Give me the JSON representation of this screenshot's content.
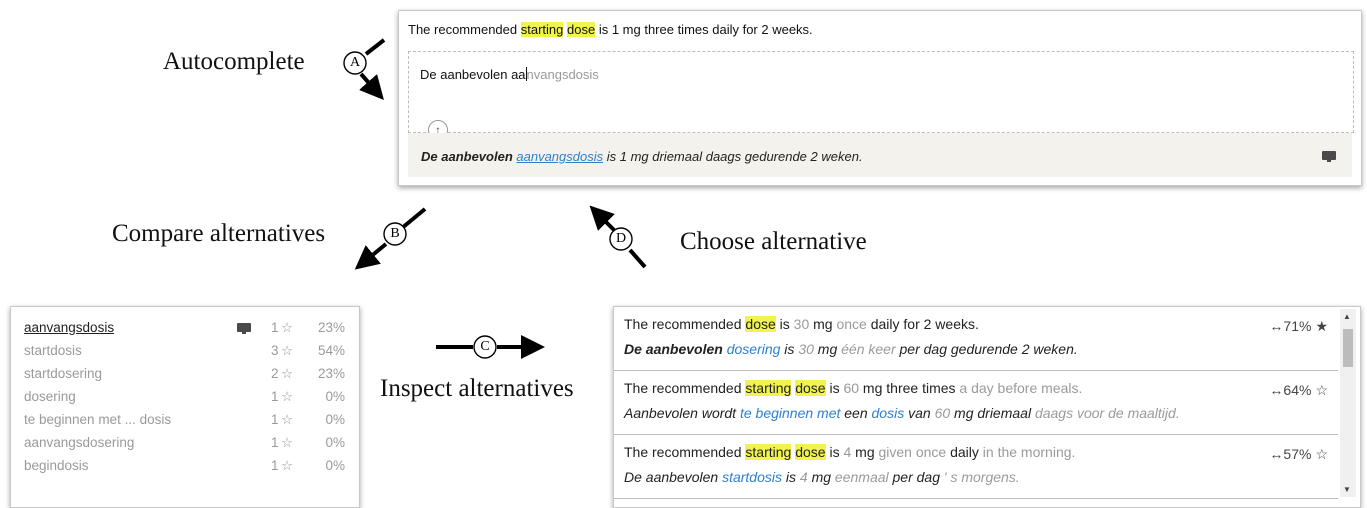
{
  "labels": {
    "autocomplete": "Autocomplete",
    "compare": "Compare alternatives",
    "inspect": "Inspect alternatives",
    "choose": "Choose alternative"
  },
  "markers": {
    "a": "A",
    "b": "B",
    "c": "C",
    "d": "D"
  },
  "editor": {
    "source": {
      "pre": "The recommended ",
      "hl1": "starting",
      "mid": " ",
      "hl2": "dose",
      "post": " is 1 mg three times daily for 2 weeks."
    },
    "input": {
      "typed": "De aanbevolen aa",
      "suggestion": "nvangsdosis"
    },
    "translation": {
      "bold": "De aanbevolen",
      "sp": " ",
      "link": "aanvangsdosis",
      "rest": " is 1 mg driemaal daags gedurende 2 weken."
    }
  },
  "alternatives": [
    {
      "term": "aanvangsdosis",
      "count": "1",
      "percent": "23%",
      "selected": true
    },
    {
      "term": "startdosis",
      "count": "3",
      "percent": "54%",
      "selected": false
    },
    {
      "term": "startdosering",
      "count": "2",
      "percent": "23%",
      "selected": false
    },
    {
      "term": "dosering",
      "count": "1",
      "percent": "0%",
      "selected": false
    },
    {
      "term": "te beginnen met ... dosis",
      "count": "1",
      "percent": "0%",
      "selected": false
    },
    {
      "term": "aanvangsdosering",
      "count": "1",
      "percent": "0%",
      "selected": false
    },
    {
      "term": "begindosis",
      "count": "1",
      "percent": "0%",
      "selected": false
    }
  ],
  "translations": [
    {
      "en": {
        "t1": "The recommended ",
        "h1": "dose",
        "t2": " is ",
        "g1": "30",
        "t3": " mg ",
        "g2": "once",
        "t4": " daily for 2 weeks."
      },
      "nl": {
        "b1": "De aanbevolen",
        "t1": " ",
        "l1": "dosering",
        "t2": " is ",
        "g1": "30",
        "t3": " mg ",
        "g2": "één keer",
        "t4": " per dag gedurende 2 weken."
      },
      "score": "↔71%",
      "star": "★"
    },
    {
      "en": {
        "t1": "The recommended ",
        "h1": "starting",
        "t2": " ",
        "h2": "dose",
        "t3": " is ",
        "g1": "60",
        "t4": " mg three times ",
        "g2": "a day before meals."
      },
      "nl": {
        "t1": "Aanbevolen wordt ",
        "l1": "te beginnen met",
        "t2": " een ",
        "l2": "dosis",
        "t3": " van ",
        "g1": "60",
        "t4": " mg driemaal ",
        "g2": "daags voor de maaltijd."
      },
      "score": "↔64%",
      "star": "☆"
    },
    {
      "en": {
        "t1": "The recommended ",
        "h1": "starting",
        "t2": " ",
        "h2": "dose",
        "t3": " is ",
        "g1": "4",
        "t4": " mg ",
        "g2": "given once",
        "t5": " daily ",
        "g3": "in the morning."
      },
      "nl": {
        "t1": "De aanbevolen ",
        "l1": "startdosis",
        "t2": " is ",
        "g1": "4",
        "t3": " mg ",
        "g2": "eenmaal",
        "t4": " per dag ",
        "g3": "' s morgens."
      },
      "score": "↔57%",
      "star": "☆"
    }
  ],
  "colors": {
    "highlight": "#f1f34f",
    "link_blue": "#2f7fcf",
    "muted_grey": "#9a9a9a",
    "panel_bg": "#f4f2ec"
  }
}
